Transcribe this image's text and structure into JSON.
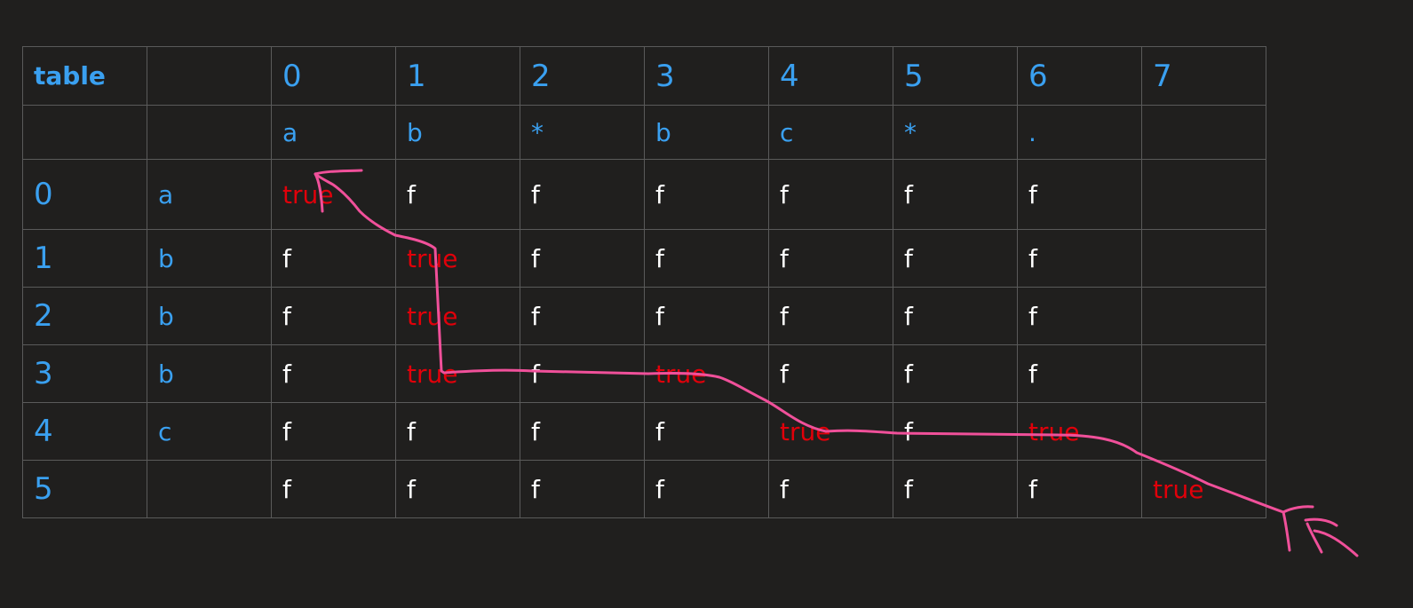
{
  "table": {
    "title": "table",
    "col_indices": [
      "0",
      "1",
      "2",
      "3",
      "4",
      "5",
      "6",
      "7"
    ],
    "pattern_chars": [
      "a",
      "b",
      "*",
      "b",
      "c",
      "*",
      ".",
      ""
    ],
    "rows": [
      {
        "index": "0",
        "char": "a",
        "cells": [
          "true",
          "f",
          "f",
          "f",
          "f",
          "f",
          "f",
          ""
        ]
      },
      {
        "index": "1",
        "char": "b",
        "cells": [
          "f",
          "true",
          "f",
          "f",
          "f",
          "f",
          "f",
          ""
        ]
      },
      {
        "index": "2",
        "char": "b",
        "cells": [
          "f",
          "true",
          "f",
          "f",
          "f",
          "f",
          "f",
          ""
        ]
      },
      {
        "index": "3",
        "char": "b",
        "cells": [
          "f",
          "true",
          "f",
          "true",
          "f",
          "f",
          "f",
          ""
        ]
      },
      {
        "index": "4",
        "char": "c",
        "cells": [
          "f",
          "f",
          "f",
          "f",
          "true",
          "f",
          "true",
          ""
        ]
      },
      {
        "index": "5",
        "char": "",
        "cells": [
          "f",
          "f",
          "f",
          "f",
          "f",
          "f",
          "f",
          "true"
        ]
      }
    ]
  },
  "colors": {
    "background": "#201f1e",
    "header_blue": "#3aa0f0",
    "true_red": "#e0000a",
    "path_pink": "#f0509a"
  }
}
